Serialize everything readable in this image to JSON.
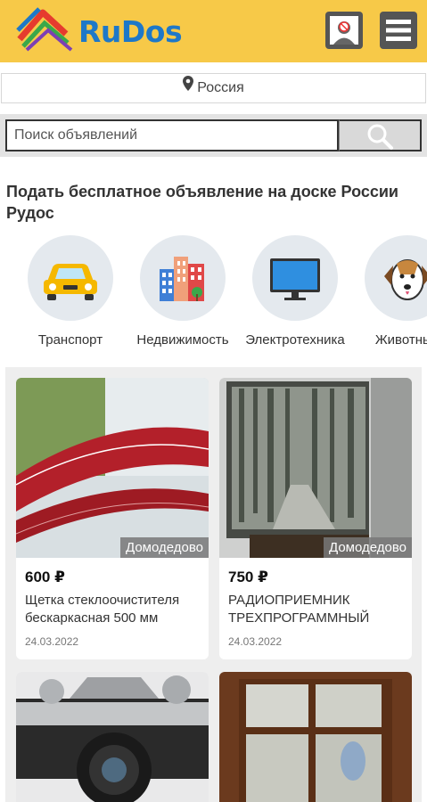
{
  "header": {
    "logo_text": "RuDos",
    "user_icon": "user-blocked-icon",
    "menu_icon": "hamburger-menu-icon",
    "brand_color": "#f7c948"
  },
  "location": {
    "label": "Россия",
    "icon": "map-pin-icon"
  },
  "search": {
    "placeholder": "Поиск объявлений",
    "icon": "search-icon"
  },
  "headline": "Подать бесплатное объявление на доске России Рудос",
  "categories": [
    {
      "label": "Транспорт",
      "icon": "car-icon"
    },
    {
      "label": "Недвижимость",
      "icon": "buildings-icon"
    },
    {
      "label": "Электротехника",
      "icon": "monitor-icon"
    },
    {
      "label": "Животные",
      "icon": "dog-icon"
    }
  ],
  "listings": [
    {
      "price": "600 ₽",
      "title": "Щетка стеклоочистителя бескаркасная 500 мм",
      "date": "24.03.2022",
      "city": "Домодедово"
    },
    {
      "price": "750 ₽",
      "title": "РАДИОПРИЕМНИК ТРЕХПРОГРАММНЫЙ",
      "date": "24.03.2022",
      "city": "Домодедово"
    },
    {
      "price": "",
      "title": "",
      "date": "",
      "city": ""
    },
    {
      "price": "",
      "title": "",
      "date": "",
      "city": ""
    }
  ]
}
